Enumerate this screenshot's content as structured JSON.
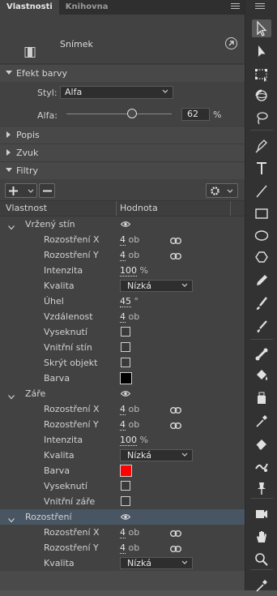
{
  "tabs": [
    {
      "label": "Vlastnosti",
      "active": true
    },
    {
      "label": "Knihovna",
      "active": false
    }
  ],
  "header": {
    "title": "Snímek"
  },
  "sections": {
    "color_effect": {
      "label": "Efekt barvy"
    },
    "style_label": "Styl:",
    "style_value": "Alfa",
    "alpha_label": "Alfa:",
    "alpha_value": "62",
    "alpha_unit": "%",
    "alpha_fraction": 0.62,
    "popis": "Popis",
    "zvuk": "Zvuk",
    "filtry": "Filtry"
  },
  "table": {
    "col1": "Vlastnost",
    "col2": "Hodnota"
  },
  "filters": [
    {
      "name": "Vržený stín",
      "props": [
        {
          "label": "Rozostření X",
          "value": "4",
          "unit": "ob",
          "link": true
        },
        {
          "label": "Rozostření Y",
          "value": "4",
          "unit": "ob",
          "link": true
        },
        {
          "label": "Intenzita",
          "value": "100",
          "unit": "%"
        },
        {
          "label": "Kvalita",
          "select": "Nízká"
        },
        {
          "label": "Úhel",
          "value": "45",
          "unit": "°"
        },
        {
          "label": "Vzdálenost",
          "value": "4",
          "unit": "ob"
        },
        {
          "label": "Vyseknutí",
          "check": true
        },
        {
          "label": "Vnitřní stín",
          "check": true
        },
        {
          "label": "Skrýt objekt",
          "check": true
        },
        {
          "label": "Barva",
          "color": "#000000"
        }
      ]
    },
    {
      "name": "Záře",
      "props": [
        {
          "label": "Rozostření X",
          "value": "4",
          "unit": "ob",
          "link": true
        },
        {
          "label": "Rozostření Y",
          "value": "4",
          "unit": "ob",
          "link": true
        },
        {
          "label": "Intenzita",
          "value": "100",
          "unit": "%"
        },
        {
          "label": "Kvalita",
          "select": "Nízká"
        },
        {
          "label": "Barva",
          "color": "#ff0000"
        },
        {
          "label": "Vyseknutí",
          "check": true
        },
        {
          "label": "Vnitřní záře",
          "check": true
        }
      ]
    },
    {
      "name": "Rozostření",
      "selected": true,
      "props": [
        {
          "label": "Rozostření X",
          "value": "4",
          "unit": "ob",
          "link": true
        },
        {
          "label": "Rozostření Y",
          "value": "4",
          "unit": "ob",
          "link": true
        },
        {
          "label": "Kvalita",
          "select": "Nízká"
        }
      ]
    }
  ],
  "tools": [
    "selection-tool",
    "subselection-tool",
    "free-transform-tool",
    "3d-rotation-tool",
    "lasso-tool",
    "pen-tool",
    "text-tool",
    "line-tool",
    "rectangle-tool",
    "oval-tool",
    "polystar-tool",
    "pencil-tool",
    "paint-brush-tool",
    "brush-tool",
    "bone-tool",
    "paint-bucket-tool",
    "ink-bottle-tool",
    "eyedropper-tool",
    "eraser-tool",
    "width-tool",
    "pin-tool",
    "camera-tool",
    "hand-tool",
    "zoom-tool",
    "eyedropper-bottom-tool"
  ]
}
